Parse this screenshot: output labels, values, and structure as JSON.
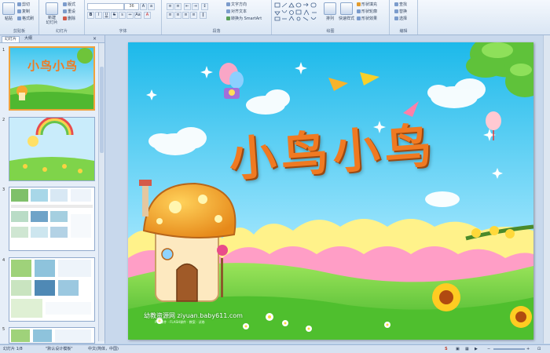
{
  "ribbon": {
    "clipboard": {
      "paste": "粘贴",
      "cut": "剪切",
      "copy": "复制",
      "format_painter": "格式刷",
      "label": "剪贴板"
    },
    "slides": {
      "new_slide": "新建\n幻灯片",
      "layout": "版式",
      "reset": "重设",
      "delete": "删除",
      "label": "幻灯片"
    },
    "font": {
      "font_name": "",
      "font_size": "36",
      "label": "字体"
    },
    "paragraph": {
      "text_direction": "文字方向",
      "align_text": "对齐文本",
      "smartart": "转换为 SmartArt",
      "label": "段落"
    },
    "drawing": {
      "arrange": "排列",
      "quick_styles": "快速样式",
      "shape_fill": "形状填充",
      "shape_outline": "形状轮廓",
      "shape_effects": "形状效果",
      "label": "绘图"
    },
    "editing": {
      "find": "查找",
      "replace": "替换",
      "select": "选择",
      "label": "编辑"
    }
  },
  "panel": {
    "tabs": [
      "幻灯片",
      "大纲"
    ],
    "slide_numbers": [
      "1",
      "2",
      "3",
      "4",
      "5"
    ],
    "thumb1_title": "小鸟小鸟"
  },
  "slide": {
    "title": "小鸟小鸟",
    "watermark_main": "幼教资源网 ziyuan.baby611.com",
    "watermark_sub": "PPT课件 · FLASH课件 · 教案 · 试卷"
  },
  "status": {
    "slide_index": "幻灯片 1/8",
    "theme": "\"默认设计模板\"",
    "language": "中文(简体，中国)"
  },
  "colors": {
    "title_orange": "#f07a22",
    "sky": "#3ec6ee",
    "grass": "#6ed13a"
  }
}
